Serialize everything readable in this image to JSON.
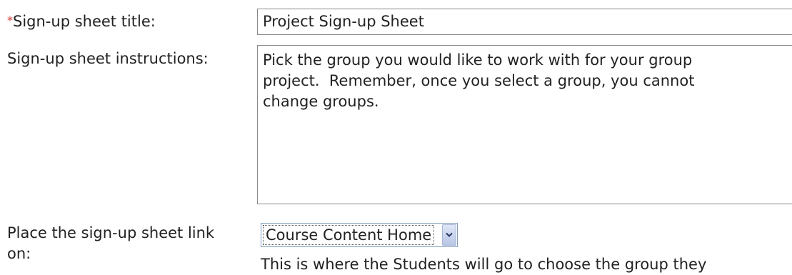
{
  "form": {
    "title_field": {
      "required_marker": "*",
      "label": "Sign-up sheet title:",
      "value": "Project Sign-up Sheet"
    },
    "instructions_field": {
      "label": "Sign-up sheet instructions:",
      "value": "Pick the group you would like to work with for your group\nproject.  Remember, once you select a group, you cannot\nchange groups."
    },
    "placement_field": {
      "label": "Place the sign-up sheet link on:",
      "selected_value": "Course Content Home",
      "dropdown_icon": "chevron-down-icon",
      "helper_text": "This is where the Students will go to choose the group they"
    }
  },
  "colors": {
    "required": "#d23b3b",
    "field_border": "#8a8a8a",
    "select_border": "#7f9db9"
  }
}
